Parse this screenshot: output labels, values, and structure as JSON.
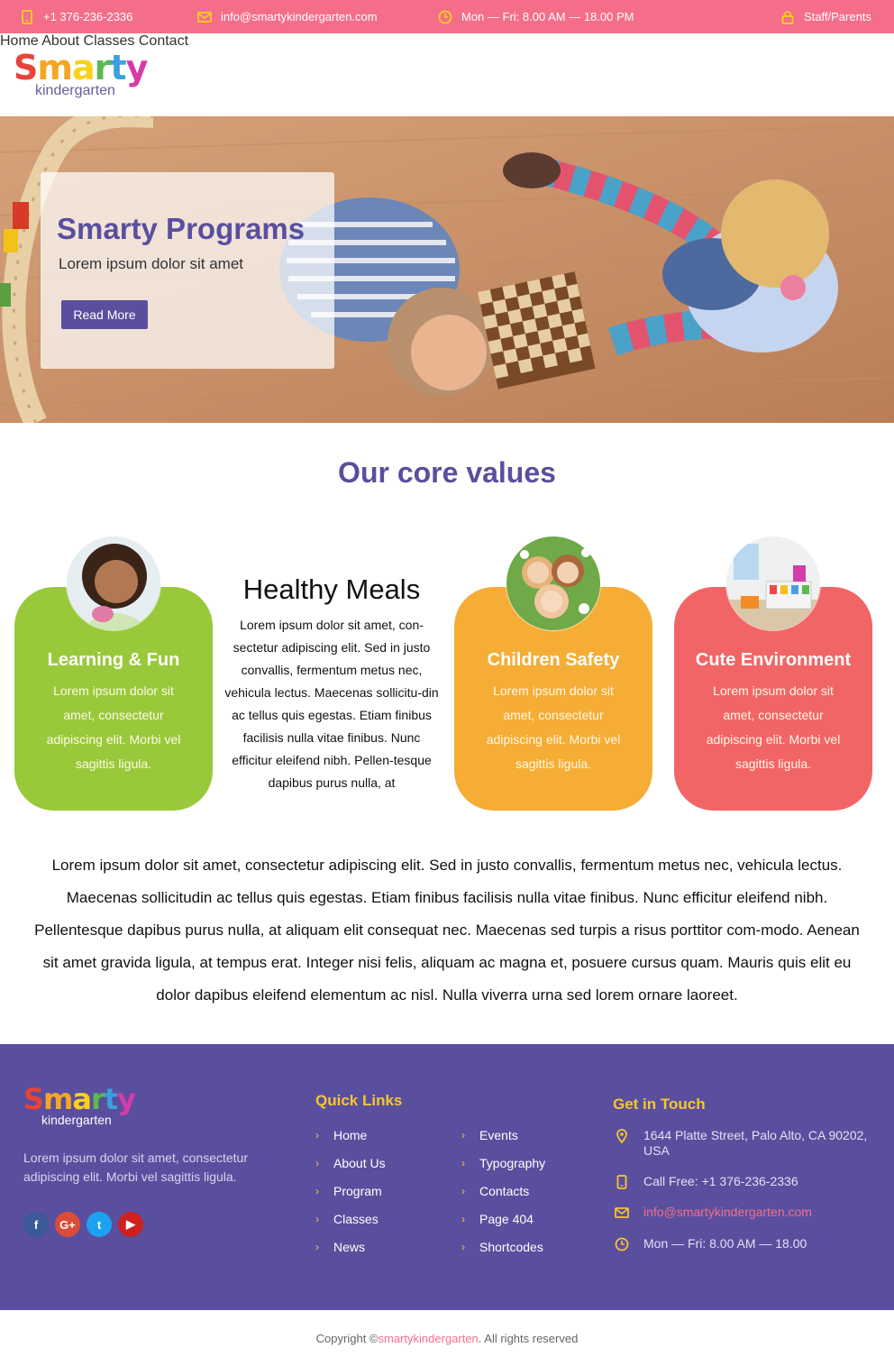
{
  "topbar": {
    "phone": "+1 376-236-2336",
    "email": "info@smartykindergarten.com",
    "hours": "Mon — Fri: 8.00 AM — 18.00 PM",
    "account": "Staff/Parents"
  },
  "logo": {
    "letters": [
      "S",
      "m",
      "a",
      "r",
      "t",
      "y"
    ],
    "letter_colors": [
      "#e8423a",
      "#f5a623",
      "#f7d21a",
      "#5ab94f",
      "#3aa0e0",
      "#d63ca8"
    ],
    "sub": "kindergarten"
  },
  "nav": {
    "items": [
      "Home",
      "About",
      "Classes",
      "Contact"
    ]
  },
  "hero": {
    "title": "Smarty Programs",
    "subtitle": "Lorem ipsum dolor sit amet",
    "button": "Read More"
  },
  "values": {
    "title": "Our core values",
    "cards": [
      {
        "title": "Learning & Fun",
        "text": "Lorem ipsum dolor sit amet, consectetur adipiscing elit. Morbi vel sagittis ligula.",
        "color": "#99c93a"
      },
      {
        "title": "Children Safety",
        "text": "Lorem ipsum dolor sit amet, consectetur adipiscing elit. Morbi vel sagittis ligula.",
        "color": "#f5ad35"
      },
      {
        "title": "Cute Environment",
        "text": "Lorem ipsum dolor sit amet, consectetur adipiscing elit. Morbi vel sagittis ligula.",
        "color": "#f26566"
      }
    ],
    "plain": {
      "title": "Healthy Meals",
      "text": "Lorem ipsum dolor sit amet, con-sectetur adipiscing elit. Sed in justo convallis, fermentum metus nec, vehicula lectus. Maecenas sollicitu-din ac tellus quis egestas. Etiam finibus facilisis nulla vitae finibus. Nunc efficitur eleifend nibh. Pellen-tesque dapibus purus nulla, at"
    }
  },
  "paragraph": "Lorem ipsum dolor sit amet, consectetur adipiscing elit. Sed in justo convallis, fermentum metus nec, vehicula lectus. Maecenas sollicitudin ac tellus quis egestas. Etiam finibus facilisis nulla vitae finibus. Nunc efficitur eleifend nibh. Pellentesque dapibus purus nulla, at aliquam elit consequat nec. Maecenas sed turpis a risus porttitor com-modo. Aenean sit amet gravida ligula, at tempus erat. Integer nisi felis, aliquam ac magna et, posuere cursus quam. Mauris quis elit eu dolor dapibus eleifend elementum ac nisl. Nulla viverra urna sed lorem ornare laoreet.",
  "footer": {
    "description": "Lorem ipsum dolor sit amet, consectetur adipiscing elit. Morbi vel sagittis ligula.",
    "social": [
      {
        "icon": "facebook-icon",
        "glyph": "f",
        "color": "#3b5998"
      },
      {
        "icon": "google-plus-icon",
        "glyph": "G+",
        "color": "#dd4b39"
      },
      {
        "icon": "twitter-icon",
        "glyph": "t",
        "color": "#1da1f2"
      },
      {
        "icon": "youtube-icon",
        "glyph": "▶",
        "color": "#cd201f"
      }
    ],
    "quick_links_title": "Quick Links",
    "links_col1": [
      "Home",
      "About Us",
      "Program",
      "Classes",
      "News"
    ],
    "links_col2": [
      "Events",
      "Typography",
      "Contacts",
      "Page 404",
      "Shortcodes"
    ],
    "contact_title": "Get in Touch",
    "address": "1644 Platte Street, Palo Alto, CA 90202, USA",
    "phone": "Call Free: +1 376-236-2336",
    "email": "info@smartykindergarten.com",
    "hours": "Mon — Fri: 8.00 AM — 18.00"
  },
  "copyright": {
    "prefix": "Copyright © ",
    "link": "smartykindergarten",
    "suffix": ". All rights reserved"
  }
}
